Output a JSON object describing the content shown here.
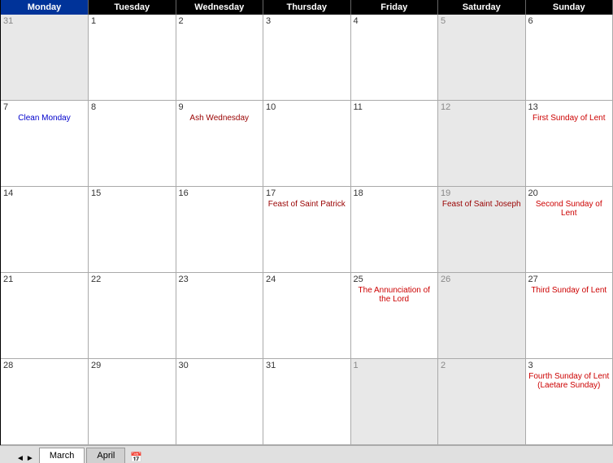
{
  "header": {
    "days": [
      "Monday",
      "Tuesday",
      "Wednesday",
      "Thursday",
      "Friday",
      "Saturday",
      "Sunday"
    ],
    "current_day": "Monday"
  },
  "weeks": [
    {
      "cells": [
        {
          "number": "31",
          "grayed": true,
          "events": []
        },
        {
          "number": "1",
          "grayed": false,
          "events": []
        },
        {
          "number": "2",
          "grayed": false,
          "events": []
        },
        {
          "number": "3",
          "grayed": false,
          "events": []
        },
        {
          "number": "4",
          "grayed": false,
          "events": []
        },
        {
          "number": "5",
          "grayed": true,
          "events": []
        },
        {
          "number": "6",
          "grayed": false,
          "events": []
        }
      ]
    },
    {
      "cells": [
        {
          "number": "7",
          "grayed": false,
          "events": [
            {
              "text": "Clean Monday",
              "color": "blue"
            }
          ]
        },
        {
          "number": "8",
          "grayed": false,
          "events": []
        },
        {
          "number": "9",
          "grayed": false,
          "events": [
            {
              "text": "Ash Wednesday",
              "color": "dark-red"
            }
          ]
        },
        {
          "number": "10",
          "grayed": false,
          "events": []
        },
        {
          "number": "11",
          "grayed": false,
          "events": []
        },
        {
          "number": "12",
          "grayed": true,
          "events": []
        },
        {
          "number": "13",
          "grayed": false,
          "events": [
            {
              "text": "First Sunday of Lent",
              "color": "red"
            }
          ]
        }
      ]
    },
    {
      "cells": [
        {
          "number": "14",
          "grayed": false,
          "events": []
        },
        {
          "number": "15",
          "grayed": false,
          "events": []
        },
        {
          "number": "16",
          "grayed": false,
          "events": []
        },
        {
          "number": "17",
          "grayed": false,
          "events": [
            {
              "text": "Feast of Saint Patrick",
              "color": "dark-red"
            }
          ]
        },
        {
          "number": "18",
          "grayed": false,
          "events": []
        },
        {
          "number": "19",
          "grayed": true,
          "events": [
            {
              "text": "Feast of Saint Joseph",
              "color": "dark-red"
            }
          ]
        },
        {
          "number": "20",
          "grayed": false,
          "events": [
            {
              "text": "Second Sunday of Lent",
              "color": "red"
            }
          ]
        }
      ]
    },
    {
      "cells": [
        {
          "number": "21",
          "grayed": false,
          "events": []
        },
        {
          "number": "22",
          "grayed": false,
          "events": []
        },
        {
          "number": "23",
          "grayed": false,
          "events": []
        },
        {
          "number": "24",
          "grayed": false,
          "events": []
        },
        {
          "number": "25",
          "grayed": false,
          "events": [
            {
              "text": "The Annunciation of the Lord",
              "color": "red"
            }
          ]
        },
        {
          "number": "26",
          "grayed": true,
          "events": []
        },
        {
          "number": "27",
          "grayed": false,
          "events": [
            {
              "text": "Third Sunday of Lent",
              "color": "red"
            }
          ]
        }
      ]
    },
    {
      "cells": [
        {
          "number": "28",
          "grayed": false,
          "events": []
        },
        {
          "number": "29",
          "grayed": false,
          "events": []
        },
        {
          "number": "30",
          "grayed": false,
          "events": []
        },
        {
          "number": "31",
          "grayed": false,
          "events": []
        },
        {
          "number": "1",
          "grayed": true,
          "events": []
        },
        {
          "number": "2",
          "grayed": true,
          "events": []
        },
        {
          "number": "3",
          "grayed": false,
          "events": [
            {
              "text": "Fourth Sunday of Lent (Laetare Sunday)",
              "color": "red"
            }
          ]
        }
      ]
    }
  ],
  "tabs": [
    {
      "label": "March",
      "active": true
    },
    {
      "label": "April",
      "active": false
    }
  ],
  "nav": {
    "prev": "◄",
    "next": "►"
  }
}
